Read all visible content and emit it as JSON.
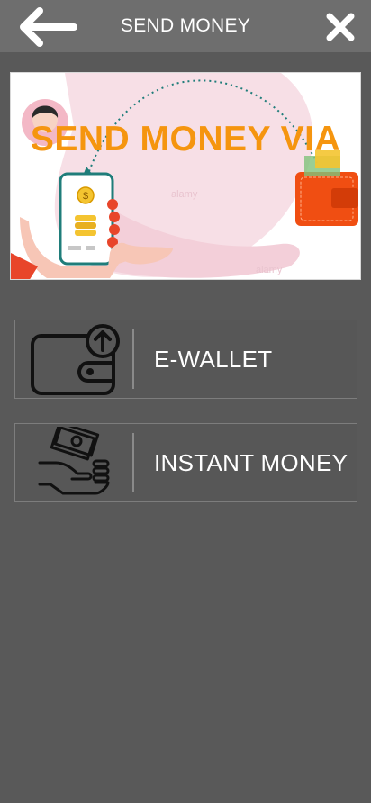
{
  "header": {
    "title": "SEND MONEY",
    "back_icon": "arrow-left-icon",
    "close_icon": "close-icon"
  },
  "banner": {
    "headline": "SEND MONEY VIA",
    "headline_color": "#f5950f",
    "watermark": "alamy"
  },
  "options": [
    {
      "label": "E-WALLET",
      "icon": "wallet-upload-icon"
    },
    {
      "label": "INSTANT MONEY",
      "icon": "hand-cash-icon"
    }
  ],
  "colors": {
    "background": "#595959",
    "topbar": "#6e6e6e",
    "option_border": "#7d7d7d",
    "text": "#ffffff"
  }
}
